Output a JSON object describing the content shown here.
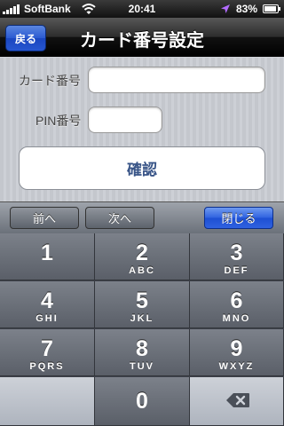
{
  "status": {
    "carrier": "SoftBank",
    "time": "20:41",
    "battery": "83%"
  },
  "nav": {
    "back_label": "戻る",
    "title": "カード番号設定"
  },
  "form": {
    "card_label": "カード番号",
    "card_value": "",
    "pin_label": "PIN番号",
    "pin_value": "",
    "confirm_label": "確認"
  },
  "accessory": {
    "prev_label": "前へ",
    "next_label": "次へ",
    "close_label": "閉じる"
  },
  "keypad": {
    "keys": [
      {
        "num": "1",
        "letters": ""
      },
      {
        "num": "2",
        "letters": "ABC"
      },
      {
        "num": "3",
        "letters": "DEF"
      },
      {
        "num": "4",
        "letters": "GHI"
      },
      {
        "num": "5",
        "letters": "JKL"
      },
      {
        "num": "6",
        "letters": "MNO"
      },
      {
        "num": "7",
        "letters": "PQRS"
      },
      {
        "num": "8",
        "letters": "TUV"
      },
      {
        "num": "9",
        "letters": "WXYZ"
      },
      {
        "num": "0",
        "letters": ""
      }
    ]
  },
  "icons": {
    "signal": "signal-bars-icon",
    "wifi": "wifi-icon",
    "location": "location-arrow-icon",
    "battery": "battery-icon",
    "delete": "backspace-icon"
  }
}
